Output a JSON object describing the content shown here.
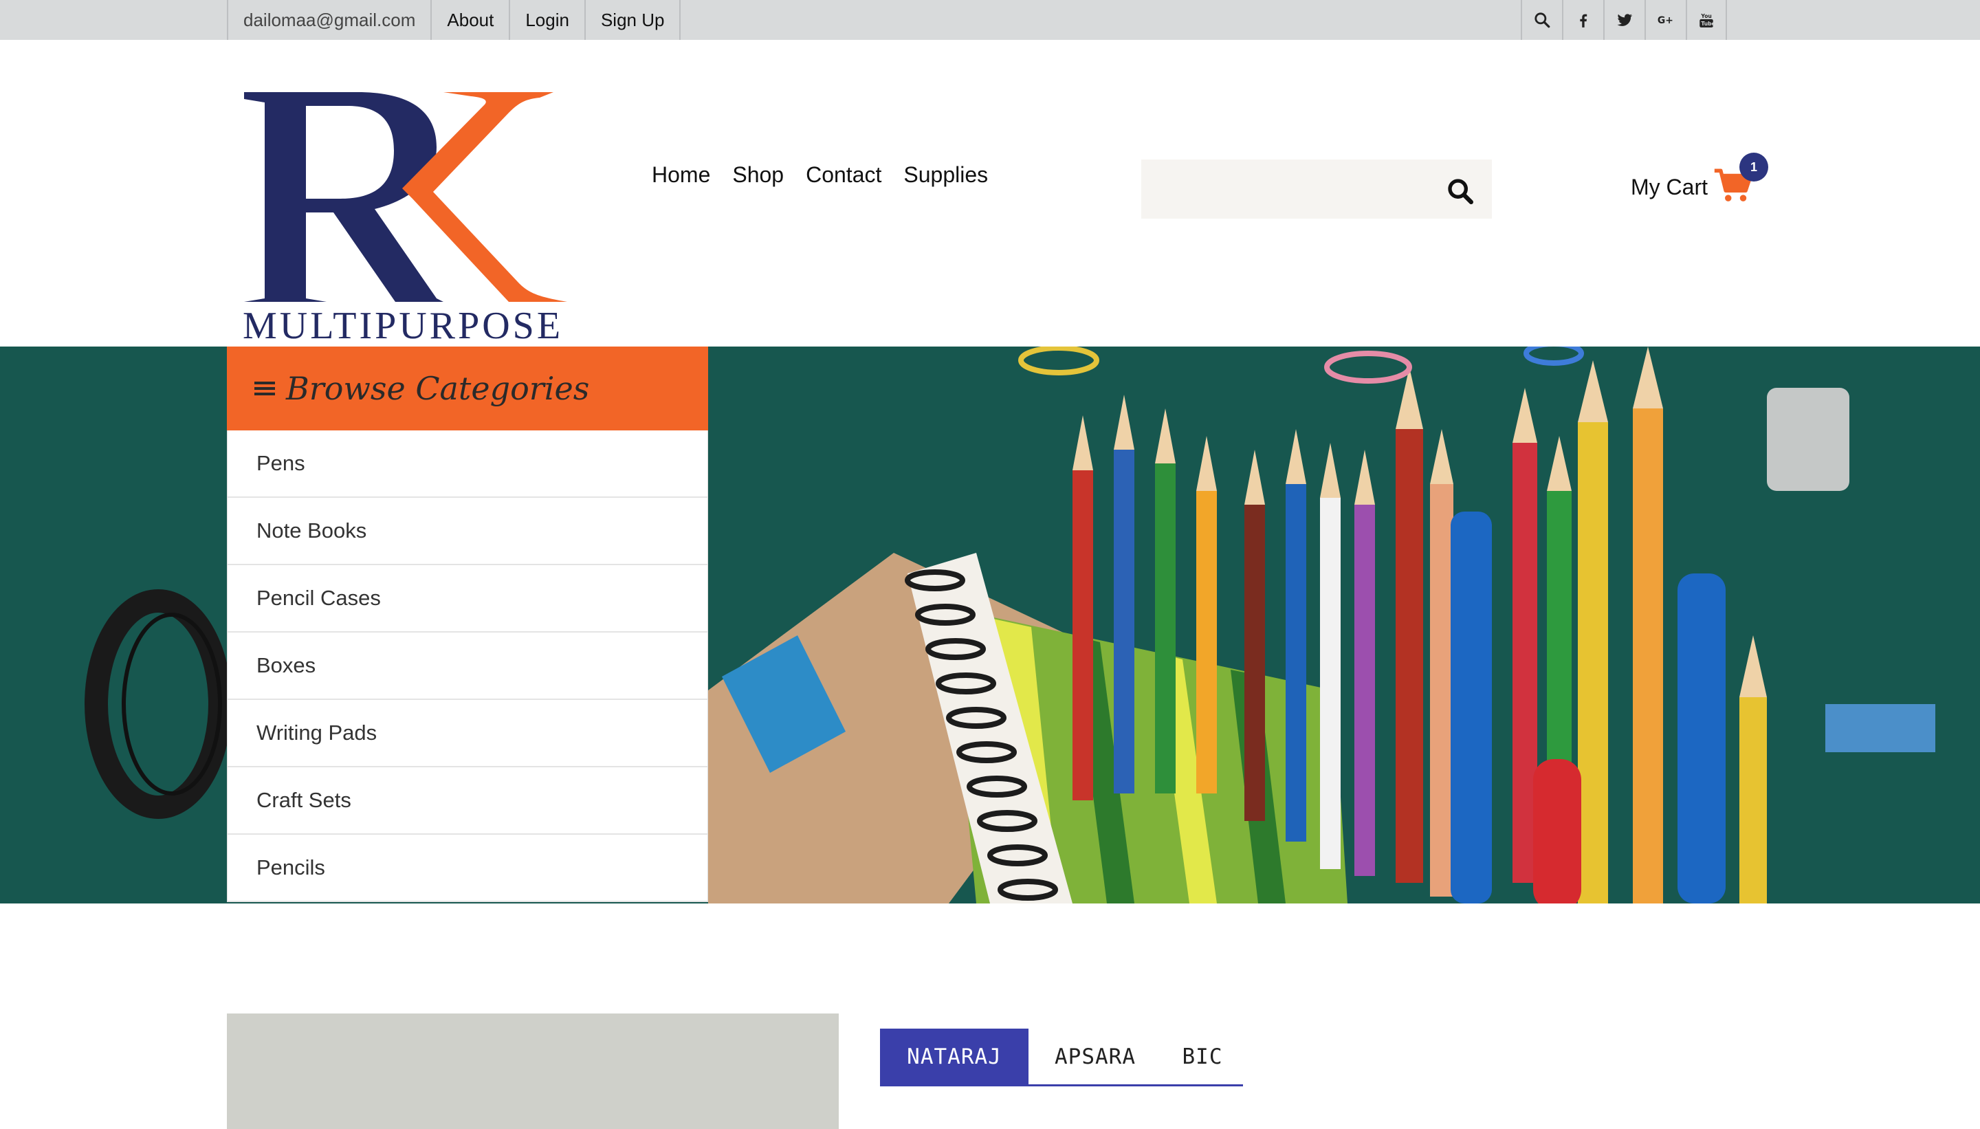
{
  "topbar": {
    "email": "dailomaa@gmail.com",
    "links": [
      "About",
      "Login",
      "Sign Up"
    ],
    "icons": [
      "search-icon",
      "facebook-icon",
      "twitter-icon",
      "google-plus-icon",
      "youtube-icon"
    ]
  },
  "logo": {
    "text": "MULTIPURPOSE",
    "letters": "RK"
  },
  "nav": {
    "items": [
      "Home",
      "Shop",
      "Contact",
      "Supplies"
    ]
  },
  "search": {
    "placeholder": ""
  },
  "cart": {
    "label": "My Cart",
    "count": "1"
  },
  "categories": {
    "title": "Browse Categories",
    "items": [
      "Pens",
      "Note Books",
      "Pencil Cases",
      "Boxes",
      "Writing Pads",
      "Craft Sets",
      "Pencils"
    ]
  },
  "brands": {
    "tabs": [
      "NATARAJ",
      "APSARA",
      "BIC"
    ],
    "active": "NATARAJ"
  },
  "colors": {
    "accent": "#f26527",
    "brand_blue": "#232a63",
    "tab_active": "#3a3faa",
    "hero_bg": "#17574f"
  }
}
